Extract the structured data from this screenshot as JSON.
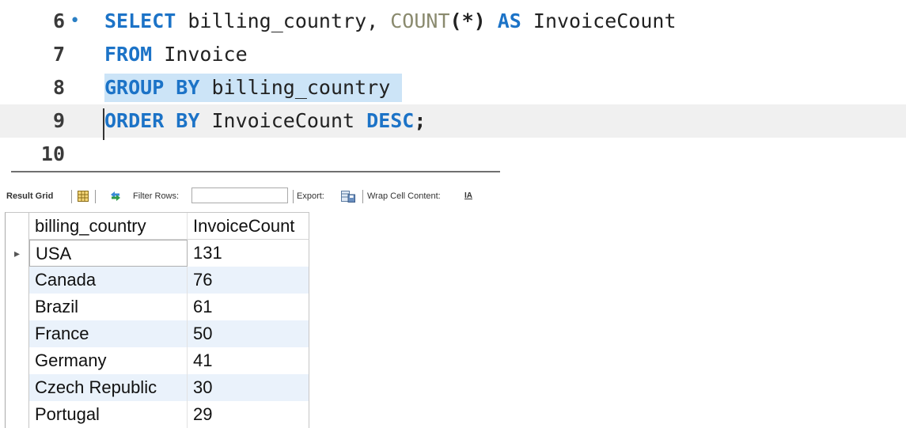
{
  "editor": {
    "lines": [
      {
        "num": "6",
        "marker": "•"
      },
      {
        "num": "7"
      },
      {
        "num": "8"
      },
      {
        "num": "9"
      },
      {
        "num": "10"
      }
    ],
    "tokens": {
      "l6": [
        "SELECT",
        " billing_country, ",
        "COUNT",
        "(*)",
        " ",
        "AS",
        " InvoiceCount"
      ],
      "l7": [
        "FROM",
        " Invoice"
      ],
      "l8": [
        "GROUP BY",
        " billing_country "
      ],
      "l9": [
        "ORDER BY",
        " InvoiceCount ",
        "DESC",
        ";"
      ]
    }
  },
  "toolbar": {
    "result_grid_label": "Result Grid",
    "filter_rows_label": "Filter Rows:",
    "filter_value": "",
    "export_label": "Export:",
    "wrap_label": "Wrap Cell Content:",
    "wrap_icon_glyph": "IA"
  },
  "grid": {
    "columns": [
      "billing_country",
      "InvoiceCount"
    ],
    "row_marker": "▸",
    "rows": [
      [
        "USA",
        "131"
      ],
      [
        "Canada",
        "76"
      ],
      [
        "Brazil",
        "61"
      ],
      [
        "France",
        "50"
      ],
      [
        "Germany",
        "41"
      ],
      [
        "Czech Republic",
        "30"
      ],
      [
        "Portugal",
        "29"
      ]
    ]
  }
}
